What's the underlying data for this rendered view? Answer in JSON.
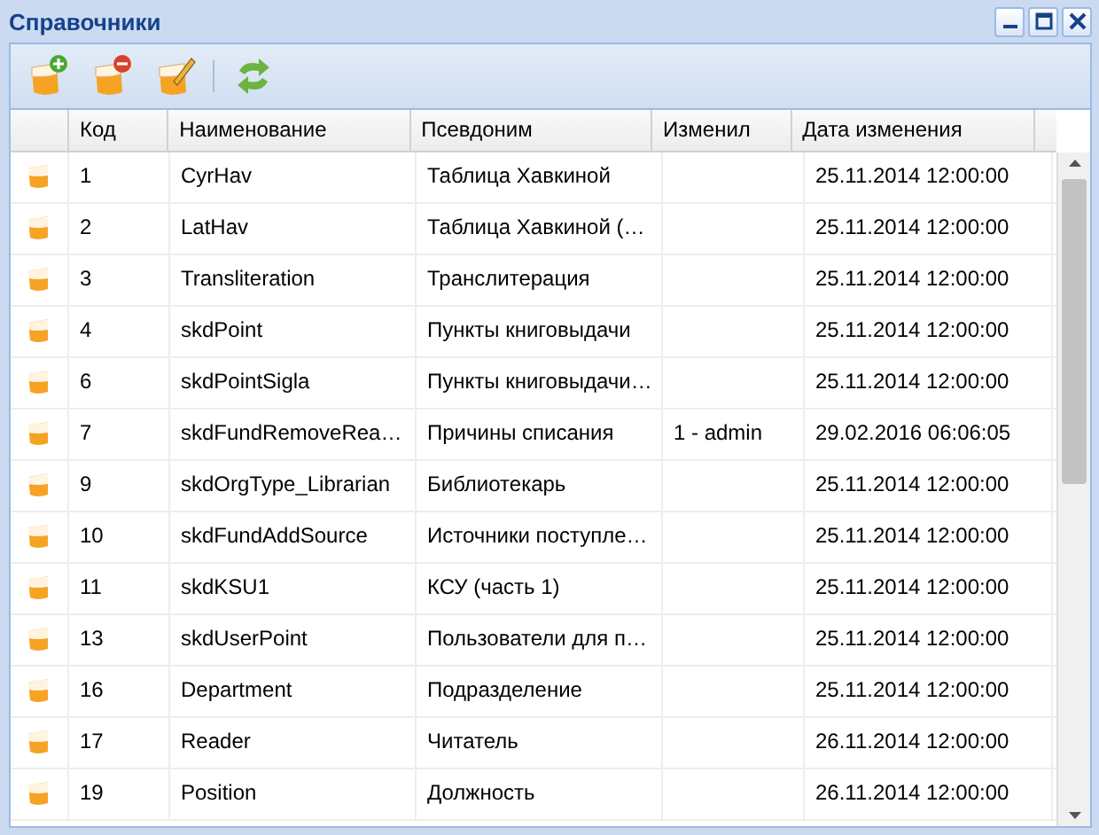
{
  "window": {
    "title": "Справочники"
  },
  "toolbar": [
    {
      "kind": "add"
    },
    {
      "kind": "remove"
    },
    {
      "kind": "edit"
    },
    {
      "kind": "refresh"
    }
  ],
  "table": {
    "columns": [
      "Код",
      "Наименование",
      "Псевдоним",
      "Изменил",
      "Дата изменения"
    ],
    "rows": [
      [
        "1",
        "CyrHav",
        "Таблица Хавкиной",
        "",
        "25.11.2014 12:00:00"
      ],
      [
        "2",
        "LatHav",
        "Таблица Хавкиной (…",
        "",
        "25.11.2014 12:00:00"
      ],
      [
        "3",
        "Transliteration",
        "Транслитерация",
        "",
        "25.11.2014 12:00:00"
      ],
      [
        "4",
        "skdPoint",
        "Пункты книговыдачи",
        "",
        "25.11.2014 12:00:00"
      ],
      [
        "6",
        "skdPointSigla",
        "Пункты книговыдачи…",
        "",
        "25.11.2014 12:00:00"
      ],
      [
        "7",
        "skdFundRemoveRea…",
        "Причины списания",
        "1 - admin",
        "29.02.2016 06:06:05"
      ],
      [
        "9",
        "skdOrgType_Librarian",
        "Библиотекарь",
        "",
        "25.11.2014 12:00:00"
      ],
      [
        "10",
        "skdFundAddSource",
        "Источники поступле…",
        "",
        "25.11.2014 12:00:00"
      ],
      [
        "11",
        "skdKSU1",
        "КСУ (часть 1)",
        "",
        "25.11.2014 12:00:00"
      ],
      [
        "13",
        "skdUserPoint",
        "Пользователи для п…",
        "",
        "25.11.2014 12:00:00"
      ],
      [
        "16",
        "Department",
        "Подразделение",
        "",
        "25.11.2014 12:00:00"
      ],
      [
        "17",
        "Reader",
        "Читатель",
        "",
        "26.11.2014 12:00:00"
      ],
      [
        "19",
        "Position",
        "Должность",
        "",
        "26.11.2014 12:00:00"
      ]
    ]
  }
}
